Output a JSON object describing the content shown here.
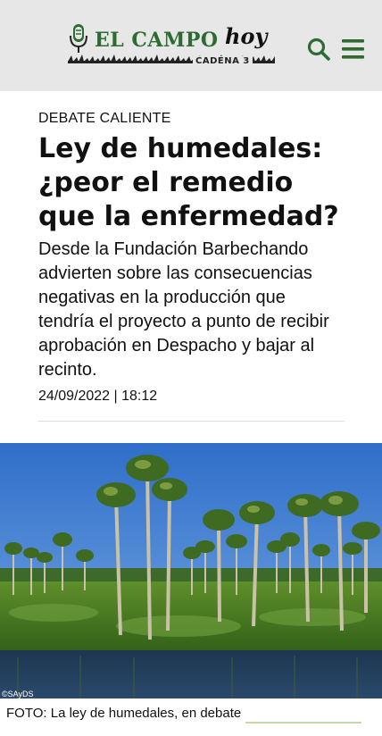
{
  "header": {
    "logo": {
      "brand": "EL CAMPO",
      "brand_accent": "hoy",
      "sub": "CADENA 3"
    },
    "icons": {
      "search": "search-icon",
      "menu": "hamburger-menu-icon"
    },
    "colors": {
      "brand_green": "#2e6b33",
      "header_bg": "#e7e7e7"
    }
  },
  "article": {
    "kicker": "DEBATE CALIENTE",
    "title": "Ley de humedales: ¿peor el remedio que la enfermedad?",
    "summary": "Desde la Fundación Barbechando advierten sobre las consecuencias negativas en la producción que tendría el proyecto a punto de recibir aprobación en Despacho y bajar al recinto.",
    "date": "24/09/2022 | 18:12"
  },
  "photo": {
    "credit": "©SAyDS",
    "caption": "FOTO: La ley de humedales, en debate"
  }
}
